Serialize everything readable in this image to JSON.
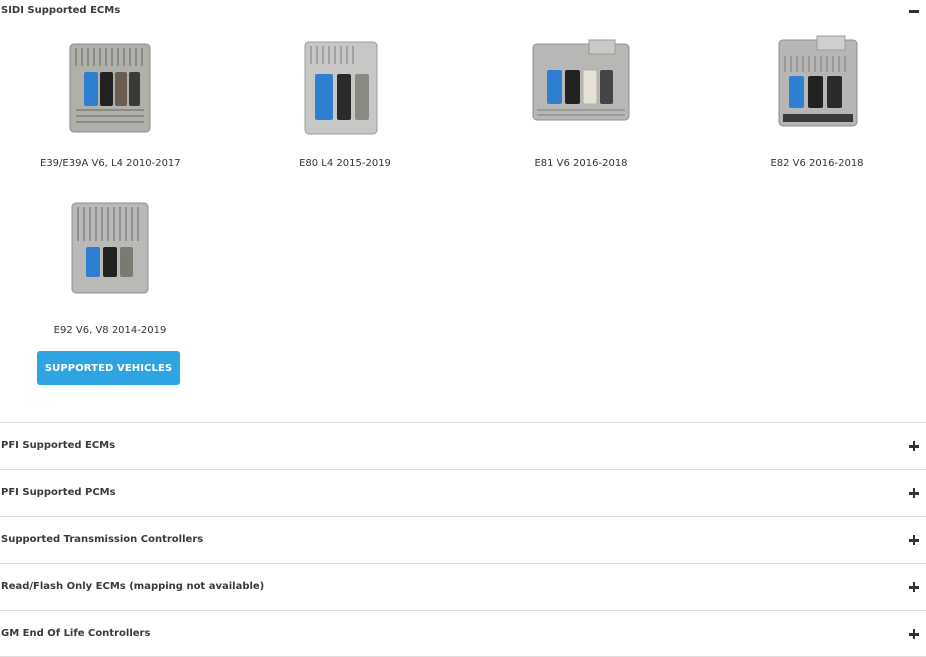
{
  "open_section": {
    "title": "SIDI Supported ECMs",
    "toggle_icon": "minus-icon",
    "ecms": [
      {
        "label": "E39/E39A V6, L4 2010-2017",
        "image": "ecm-module-image"
      },
      {
        "label": "E80 L4 2015-2019",
        "image": "ecm-module-image"
      },
      {
        "label": "E81 V6 2016-2018",
        "image": "ecm-module-image"
      },
      {
        "label": "E82 V6 2016-2018",
        "image": "ecm-module-image"
      },
      {
        "label": "E92 V6, V8 2014-2019",
        "image": "ecm-module-image"
      }
    ],
    "button_label": "SUPPORTED VEHICLES"
  },
  "collapsed_sections": [
    {
      "title": "PFI Supported ECMs",
      "toggle_icon": "plus-icon"
    },
    {
      "title": "PFI Supported PCMs",
      "toggle_icon": "plus-icon"
    },
    {
      "title": "Supported Transmission Controllers",
      "toggle_icon": "plus-icon"
    },
    {
      "title": "Read/Flash Only ECMs (mapping not available)",
      "toggle_icon": "plus-icon"
    },
    {
      "title": "GM End Of Life Controllers",
      "toggle_icon": "plus-icon"
    }
  ],
  "colors": {
    "button": "#2ea4e2",
    "connector_blue": "#2f7fd0",
    "connector_black": "#222222",
    "connector_grey": "#8a8a82",
    "connector_white": "#e6e2d6",
    "divider": "#dedede"
  }
}
